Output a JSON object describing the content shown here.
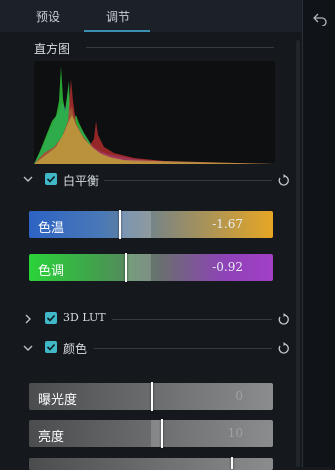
{
  "tabs": [
    {
      "label": "预设",
      "active": false
    },
    {
      "label": "调节",
      "active": true
    }
  ],
  "histogram": {
    "title": "直方图"
  },
  "white_balance": {
    "label": "白平衡",
    "checked": true,
    "temperature": {
      "label": "色温",
      "value": "-1.67"
    },
    "tint": {
      "label": "色调",
      "value": "-0.92"
    }
  },
  "lut": {
    "label": "3D LUT",
    "checked": true
  },
  "color": {
    "label": "颜色",
    "checked": true,
    "exposure": {
      "label": "曝光度",
      "value": "0"
    },
    "brightness": {
      "label": "亮度",
      "value": "10"
    }
  },
  "colors": {
    "accent": "#3b8fb0",
    "checkbox": "#40b8c8"
  },
  "icons": [
    "back-arrow-icon",
    "chevron-down-icon",
    "chevron-right-icon",
    "checkmark-icon",
    "reset-icon"
  ]
}
